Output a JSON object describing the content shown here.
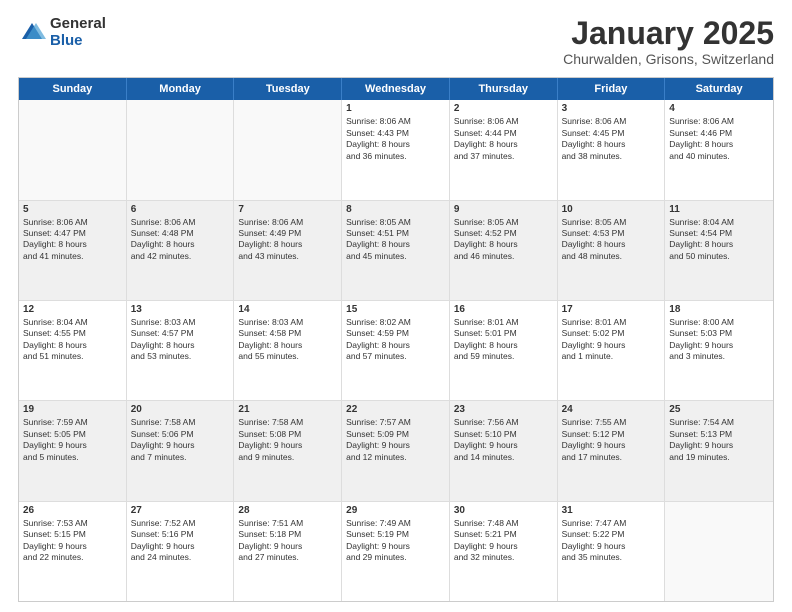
{
  "logo": {
    "general": "General",
    "blue": "Blue"
  },
  "title": "January 2025",
  "location": "Churwalden, Grisons, Switzerland",
  "days": [
    "Sunday",
    "Monday",
    "Tuesday",
    "Wednesday",
    "Thursday",
    "Friday",
    "Saturday"
  ],
  "weeks": [
    [
      {
        "day": "",
        "text": ""
      },
      {
        "day": "",
        "text": ""
      },
      {
        "day": "",
        "text": ""
      },
      {
        "day": "1",
        "text": "Sunrise: 8:06 AM\nSunset: 4:43 PM\nDaylight: 8 hours\nand 36 minutes."
      },
      {
        "day": "2",
        "text": "Sunrise: 8:06 AM\nSunset: 4:44 PM\nDaylight: 8 hours\nand 37 minutes."
      },
      {
        "day": "3",
        "text": "Sunrise: 8:06 AM\nSunset: 4:45 PM\nDaylight: 8 hours\nand 38 minutes."
      },
      {
        "day": "4",
        "text": "Sunrise: 8:06 AM\nSunset: 4:46 PM\nDaylight: 8 hours\nand 40 minutes."
      }
    ],
    [
      {
        "day": "5",
        "text": "Sunrise: 8:06 AM\nSunset: 4:47 PM\nDaylight: 8 hours\nand 41 minutes."
      },
      {
        "day": "6",
        "text": "Sunrise: 8:06 AM\nSunset: 4:48 PM\nDaylight: 8 hours\nand 42 minutes."
      },
      {
        "day": "7",
        "text": "Sunrise: 8:06 AM\nSunset: 4:49 PM\nDaylight: 8 hours\nand 43 minutes."
      },
      {
        "day": "8",
        "text": "Sunrise: 8:05 AM\nSunset: 4:51 PM\nDaylight: 8 hours\nand 45 minutes."
      },
      {
        "day": "9",
        "text": "Sunrise: 8:05 AM\nSunset: 4:52 PM\nDaylight: 8 hours\nand 46 minutes."
      },
      {
        "day": "10",
        "text": "Sunrise: 8:05 AM\nSunset: 4:53 PM\nDaylight: 8 hours\nand 48 minutes."
      },
      {
        "day": "11",
        "text": "Sunrise: 8:04 AM\nSunset: 4:54 PM\nDaylight: 8 hours\nand 50 minutes."
      }
    ],
    [
      {
        "day": "12",
        "text": "Sunrise: 8:04 AM\nSunset: 4:55 PM\nDaylight: 8 hours\nand 51 minutes."
      },
      {
        "day": "13",
        "text": "Sunrise: 8:03 AM\nSunset: 4:57 PM\nDaylight: 8 hours\nand 53 minutes."
      },
      {
        "day": "14",
        "text": "Sunrise: 8:03 AM\nSunset: 4:58 PM\nDaylight: 8 hours\nand 55 minutes."
      },
      {
        "day": "15",
        "text": "Sunrise: 8:02 AM\nSunset: 4:59 PM\nDaylight: 8 hours\nand 57 minutes."
      },
      {
        "day": "16",
        "text": "Sunrise: 8:01 AM\nSunset: 5:01 PM\nDaylight: 8 hours\nand 59 minutes."
      },
      {
        "day": "17",
        "text": "Sunrise: 8:01 AM\nSunset: 5:02 PM\nDaylight: 9 hours\nand 1 minute."
      },
      {
        "day": "18",
        "text": "Sunrise: 8:00 AM\nSunset: 5:03 PM\nDaylight: 9 hours\nand 3 minutes."
      }
    ],
    [
      {
        "day": "19",
        "text": "Sunrise: 7:59 AM\nSunset: 5:05 PM\nDaylight: 9 hours\nand 5 minutes."
      },
      {
        "day": "20",
        "text": "Sunrise: 7:58 AM\nSunset: 5:06 PM\nDaylight: 9 hours\nand 7 minutes."
      },
      {
        "day": "21",
        "text": "Sunrise: 7:58 AM\nSunset: 5:08 PM\nDaylight: 9 hours\nand 9 minutes."
      },
      {
        "day": "22",
        "text": "Sunrise: 7:57 AM\nSunset: 5:09 PM\nDaylight: 9 hours\nand 12 minutes."
      },
      {
        "day": "23",
        "text": "Sunrise: 7:56 AM\nSunset: 5:10 PM\nDaylight: 9 hours\nand 14 minutes."
      },
      {
        "day": "24",
        "text": "Sunrise: 7:55 AM\nSunset: 5:12 PM\nDaylight: 9 hours\nand 17 minutes."
      },
      {
        "day": "25",
        "text": "Sunrise: 7:54 AM\nSunset: 5:13 PM\nDaylight: 9 hours\nand 19 minutes."
      }
    ],
    [
      {
        "day": "26",
        "text": "Sunrise: 7:53 AM\nSunset: 5:15 PM\nDaylight: 9 hours\nand 22 minutes."
      },
      {
        "day": "27",
        "text": "Sunrise: 7:52 AM\nSunset: 5:16 PM\nDaylight: 9 hours\nand 24 minutes."
      },
      {
        "day": "28",
        "text": "Sunrise: 7:51 AM\nSunset: 5:18 PM\nDaylight: 9 hours\nand 27 minutes."
      },
      {
        "day": "29",
        "text": "Sunrise: 7:49 AM\nSunset: 5:19 PM\nDaylight: 9 hours\nand 29 minutes."
      },
      {
        "day": "30",
        "text": "Sunrise: 7:48 AM\nSunset: 5:21 PM\nDaylight: 9 hours\nand 32 minutes."
      },
      {
        "day": "31",
        "text": "Sunrise: 7:47 AM\nSunset: 5:22 PM\nDaylight: 9 hours\nand 35 minutes."
      },
      {
        "day": "",
        "text": ""
      }
    ]
  ]
}
